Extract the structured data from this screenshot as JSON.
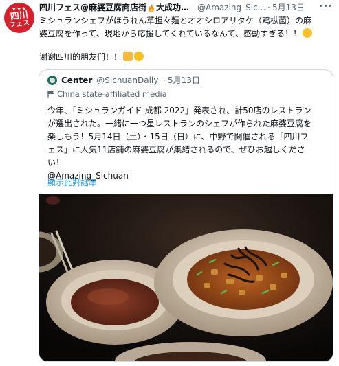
{
  "tweet": {
    "avatar": {
      "badge_text": "四川フェス",
      "stars": "★★★"
    },
    "name_part1": "四川フェス@麻婆豆腐商店街",
    "name_part2": "大成功…",
    "handle": "@Amazing_Sic...",
    "dot": "·",
    "date": "5月13日",
    "text_line1": "ミシュランシェフがほうれん草担々麺とオオシロアリタケ（鸡枞菌）の麻",
    "text_line2": "婆豆腐を作って、現地から応援してくれているなんて、感動すぎる！！",
    "text_line3": "谢谢四川的朋友们！！",
    "icons": {
      "flame": "fire-icon",
      "cry": "crying-face-icon",
      "clap": "clapping-hands-icon",
      "smile": "grinning-face-icon",
      "more": "more-icon"
    }
  },
  "quote": {
    "name": "Center",
    "handle": "@SichuanDaily",
    "dot": "·",
    "date": "5月13日",
    "label": "China state-affiliated media",
    "text_lines": [
      "今年、「ミシュランガイド 成都 2022」発表され、計50店のレストラン",
      "が選出された。一緒に一つ星レストランのシェフが作られた麻婆豆腐を",
      "楽しもう！5月14日（土）・15日（日）に、中野で開催される「四川フ",
      "ェス」に人気11店舗の麻婆豆腐が集結されるので、ぜひお越しくださ",
      "い！",
      "@Amazing_Sichuan"
    ],
    "show_thread": "顯示此對話串",
    "photo_alt": "Two bowls of Sichuan dishes on a dark table"
  },
  "colors": {
    "text": "#0f1419",
    "secondary": "#536471",
    "link": "#1d9bf0",
    "border": "#cfd9de",
    "brand_red": "#d6202b"
  }
}
